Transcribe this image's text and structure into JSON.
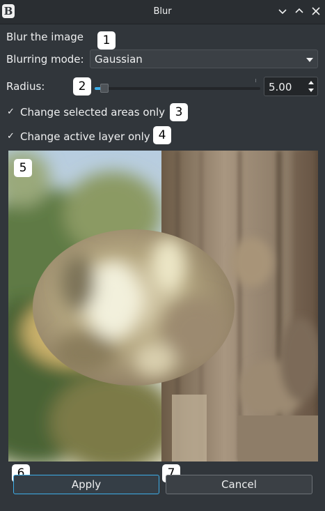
{
  "window": {
    "title": "Blur"
  },
  "dialog": {
    "heading": "Blur the image",
    "mode_label": "Blurring mode:",
    "mode_value": "Gaussian",
    "radius_label": "Radius:",
    "radius_value": "5.00",
    "radius_fraction": 0.06,
    "change_selected_label": "Change selected areas only",
    "change_selected_checked": true,
    "change_layer_label": "Change active layer only",
    "change_layer_checked": true,
    "apply_label": "Apply",
    "cancel_label": "Cancel"
  },
  "badges": [
    "1",
    "2",
    "3",
    "4",
    "5",
    "6",
    "7"
  ],
  "icons": [
    "app-icon",
    "minimize-icon",
    "maximize-icon",
    "close-icon",
    "chevron-down-icon",
    "check-icon",
    "spin-up-icon",
    "spin-down-icon"
  ],
  "colors": {
    "accent": "#3daee9",
    "window_bg": "#31363b",
    "text": "#eff0f1"
  }
}
